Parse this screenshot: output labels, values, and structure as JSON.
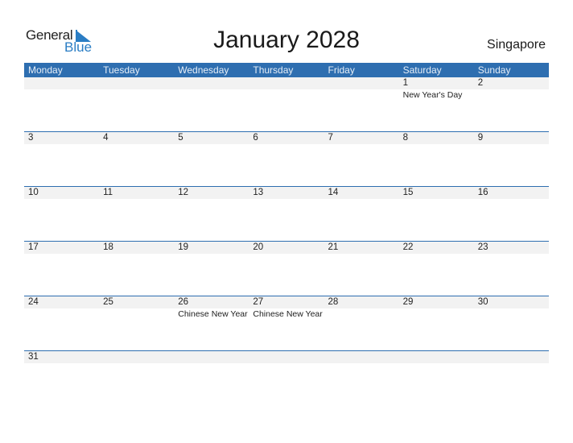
{
  "logo": {
    "general": "General",
    "blue": "Blue"
  },
  "title": "January 2028",
  "country": "Singapore",
  "colors": {
    "accent": "#2e6eb0",
    "band": "#f2f2f2",
    "logo_blue": "#2a7dc4"
  },
  "days": [
    "Monday",
    "Tuesday",
    "Wednesday",
    "Thursday",
    "Friday",
    "Saturday",
    "Sunday"
  ],
  "weeks": [
    [
      {
        "d": "",
        "e": ""
      },
      {
        "d": "",
        "e": ""
      },
      {
        "d": "",
        "e": ""
      },
      {
        "d": "",
        "e": ""
      },
      {
        "d": "",
        "e": ""
      },
      {
        "d": "1",
        "e": "New Year's Day"
      },
      {
        "d": "2",
        "e": ""
      }
    ],
    [
      {
        "d": "3",
        "e": ""
      },
      {
        "d": "4",
        "e": ""
      },
      {
        "d": "5",
        "e": ""
      },
      {
        "d": "6",
        "e": ""
      },
      {
        "d": "7",
        "e": ""
      },
      {
        "d": "8",
        "e": ""
      },
      {
        "d": "9",
        "e": ""
      }
    ],
    [
      {
        "d": "10",
        "e": ""
      },
      {
        "d": "11",
        "e": ""
      },
      {
        "d": "12",
        "e": ""
      },
      {
        "d": "13",
        "e": ""
      },
      {
        "d": "14",
        "e": ""
      },
      {
        "d": "15",
        "e": ""
      },
      {
        "d": "16",
        "e": ""
      }
    ],
    [
      {
        "d": "17",
        "e": ""
      },
      {
        "d": "18",
        "e": ""
      },
      {
        "d": "19",
        "e": ""
      },
      {
        "d": "20",
        "e": ""
      },
      {
        "d": "21",
        "e": ""
      },
      {
        "d": "22",
        "e": ""
      },
      {
        "d": "23",
        "e": ""
      }
    ],
    [
      {
        "d": "24",
        "e": ""
      },
      {
        "d": "25",
        "e": ""
      },
      {
        "d": "26",
        "e": "Chinese New Year"
      },
      {
        "d": "27",
        "e": "Chinese New Year"
      },
      {
        "d": "28",
        "e": ""
      },
      {
        "d": "29",
        "e": ""
      },
      {
        "d": "30",
        "e": ""
      }
    ],
    [
      {
        "d": "31",
        "e": ""
      },
      {
        "d": "",
        "e": ""
      },
      {
        "d": "",
        "e": ""
      },
      {
        "d": "",
        "e": ""
      },
      {
        "d": "",
        "e": ""
      },
      {
        "d": "",
        "e": ""
      },
      {
        "d": "",
        "e": ""
      }
    ]
  ]
}
